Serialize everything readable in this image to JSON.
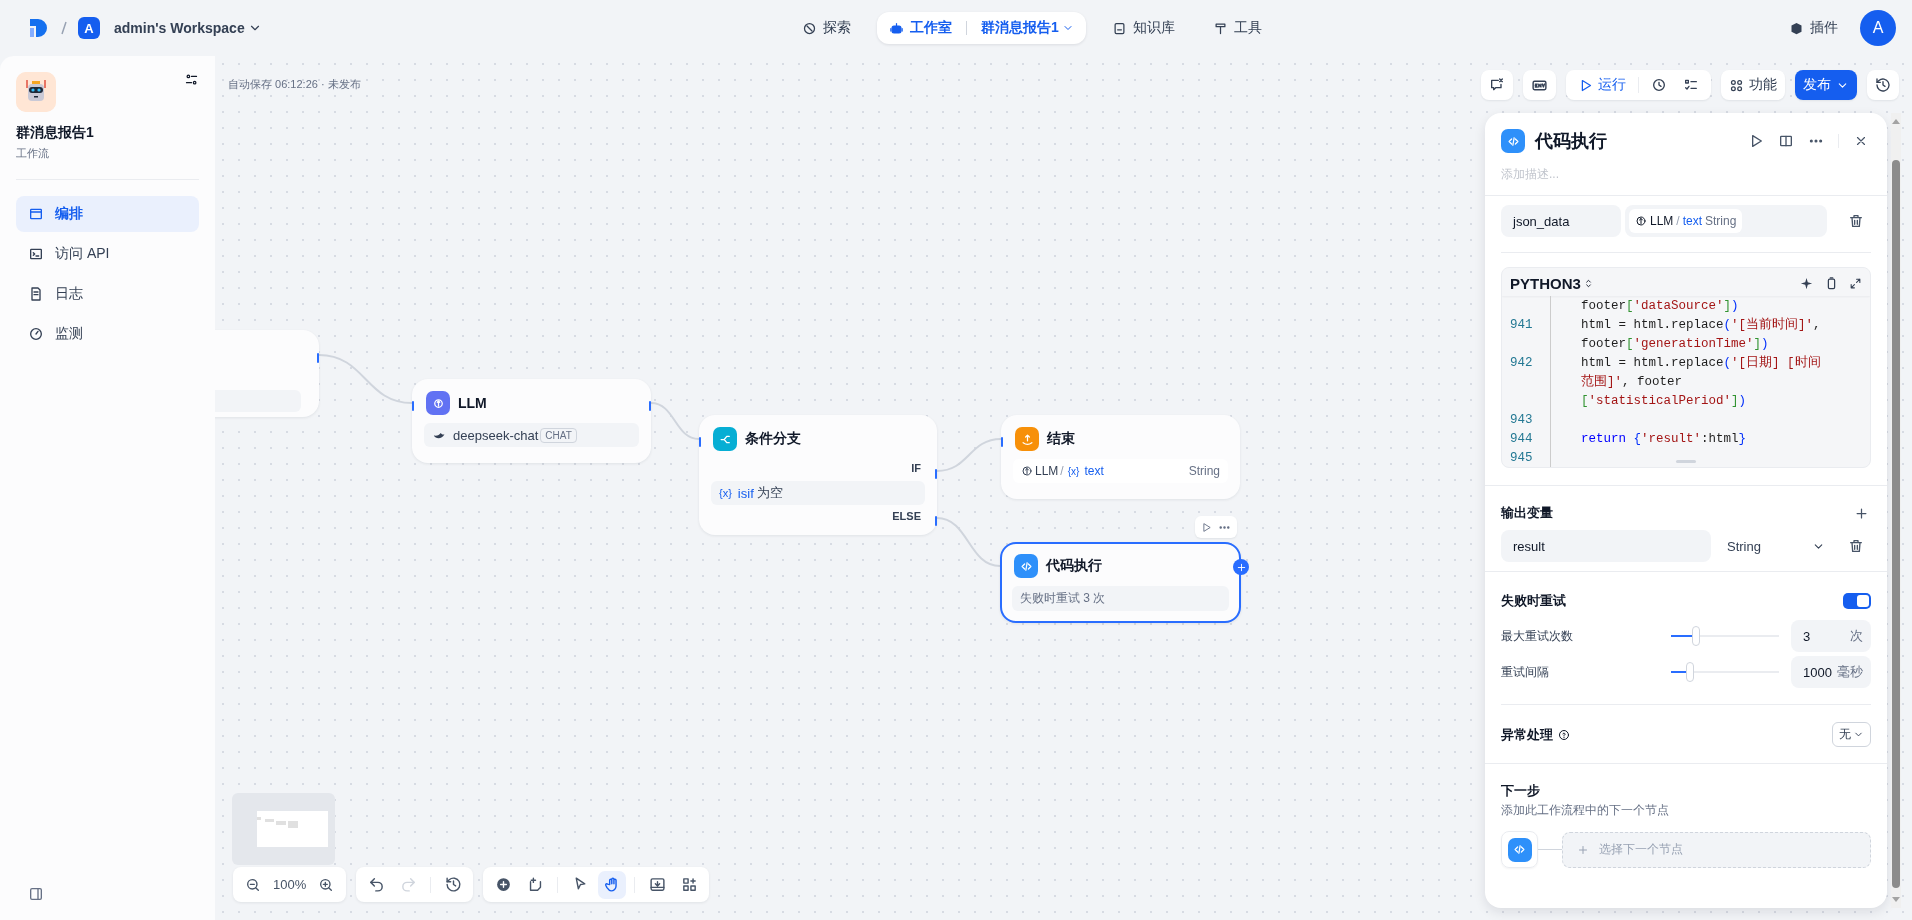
{
  "topbar": {
    "workspace_initial": "A",
    "workspace": "admin's Workspace",
    "nav": [
      {
        "kind": "explore",
        "label": "探索",
        "selected": false
      },
      {
        "kind": "studio",
        "label": "工作室",
        "selected": true,
        "sub": "群消息报告1"
      },
      {
        "kind": "knowledge",
        "label": "知识库",
        "selected": false
      },
      {
        "kind": "tools",
        "label": "工具",
        "selected": false
      }
    ],
    "plugins": "插件",
    "avatar": "A"
  },
  "sidebar": {
    "app_name": "群消息报告1",
    "app_type": "工作流",
    "items": [
      {
        "kind": "orchestrate",
        "label": "编排",
        "selected": true
      },
      {
        "kind": "api",
        "label": "访问 API",
        "selected": false
      },
      {
        "kind": "logs",
        "label": "日志",
        "selected": false
      },
      {
        "kind": "monitor",
        "label": "监测",
        "selected": false
      }
    ]
  },
  "canvas": {
    "autosave": "自动保存 06:12:26 · 未发布",
    "toolbar": {
      "run": "运行",
      "features": "功能",
      "publish": "发布"
    },
    "nodes": [
      {
        "kind": "partial",
        "selected": false
      },
      {
        "kind": "llm",
        "title": "LLM",
        "model": "deepseek-chat",
        "tag": "CHAT",
        "selected": false
      },
      {
        "kind": "if-else",
        "title": "条件分支",
        "if_label": "IF",
        "else_label": "ELSE",
        "condition": {
          "var_icon": "{x}",
          "var": "isif",
          "operator": "为空"
        },
        "selected": false
      },
      {
        "kind": "end",
        "title": "结束",
        "output": {
          "source": "LLM",
          "separator": "/",
          "var_icon": "{x}",
          "var": "text",
          "type": "String"
        },
        "selected": false
      },
      {
        "kind": "code",
        "title": "代码执行",
        "retry": "失败时重试 3 次",
        "selected": true
      }
    ],
    "zoom": "100%",
    "history": [
      {
        "kind": "undo",
        "disabled": false
      },
      {
        "kind": "redo",
        "disabled": true
      },
      {
        "kind": "history",
        "disabled": false
      }
    ],
    "tools": [
      {
        "kind": "add-node",
        "selected": false
      },
      {
        "kind": "note",
        "selected": false
      },
      {
        "kind": "pointer",
        "selected": false
      },
      {
        "kind": "hand",
        "selected": true
      },
      {
        "kind": "export",
        "selected": false
      },
      {
        "kind": "layout",
        "selected": false
      }
    ]
  },
  "panel": {
    "title": "代码执行",
    "description_placeholder": "添加描述...",
    "inputs": [
      {
        "name": "json_data",
        "source": "LLM",
        "separator": "/",
        "var": "text",
        "type": "String"
      }
    ],
    "language": "PYTHON3",
    "code_lines": [
      {
        "segments": [
          {
            "kind": "plain",
            "text": "footer"
          },
          {
            "kind": "bracket",
            "text": "["
          },
          {
            "kind": "string",
            "text": "'dataSource'"
          },
          {
            "kind": "bracket",
            "text": "]"
          },
          {
            "kind": "paren",
            "text": ")"
          }
        ]
      },
      {
        "number": "941",
        "segments": [
          {
            "kind": "plain",
            "text": "html = html.replace"
          },
          {
            "kind": "paren",
            "text": "("
          },
          {
            "kind": "string",
            "text": "'[当前时间]'"
          },
          {
            "kind": "plain",
            "text": ","
          }
        ]
      },
      {
        "segments": [
          {
            "kind": "plain",
            "text": "footer"
          },
          {
            "kind": "bracket",
            "text": "["
          },
          {
            "kind": "string",
            "text": "'generationTime'"
          },
          {
            "kind": "bracket",
            "text": "]"
          },
          {
            "kind": "paren",
            "text": ")"
          }
        ]
      },
      {
        "number": "942",
        "segments": [
          {
            "kind": "plain",
            "text": "html = html.replace"
          },
          {
            "kind": "paren",
            "text": "("
          },
          {
            "kind": "string",
            "text": "'[日期] [时间"
          }
        ]
      },
      {
        "segments": [
          {
            "kind": "string",
            "text": "范围]'"
          },
          {
            "kind": "plain",
            "text": ", footer"
          }
        ]
      },
      {
        "segments": [
          {
            "kind": "bracket",
            "text": "["
          },
          {
            "kind": "string",
            "text": "'statisticalPeriod'"
          },
          {
            "kind": "bracket",
            "text": "]"
          },
          {
            "kind": "paren",
            "text": ")"
          }
        ]
      },
      {
        "number": "943"
      },
      {
        "number": "944",
        "segments": [
          {
            "kind": "keyword",
            "text": "return "
          },
          {
            "kind": "paren",
            "text": "{"
          },
          {
            "kind": "string",
            "text": "'result'"
          },
          {
            "kind": "plain",
            "text": ":html"
          },
          {
            "kind": "paren",
            "text": "}"
          }
        ]
      },
      {
        "number": "945"
      }
    ],
    "output_label": "输出变量",
    "outputs": [
      {
        "name": "result",
        "type": "String"
      }
    ],
    "retry": {
      "label": "失败时重试",
      "on": true,
      "params": [
        {
          "label": "最大重试次数",
          "level": 0.23,
          "value": "3",
          "unit": "次"
        },
        {
          "label": "重试间隔",
          "level": 0.18,
          "value": "1000",
          "unit": "毫秒"
        }
      ]
    },
    "error_handling": {
      "label": "异常处理",
      "value": "无"
    },
    "next_step": {
      "title": "下一步",
      "description": "添加此工作流程中的下一个节点",
      "placeholder": "选择下一个节点"
    }
  }
}
